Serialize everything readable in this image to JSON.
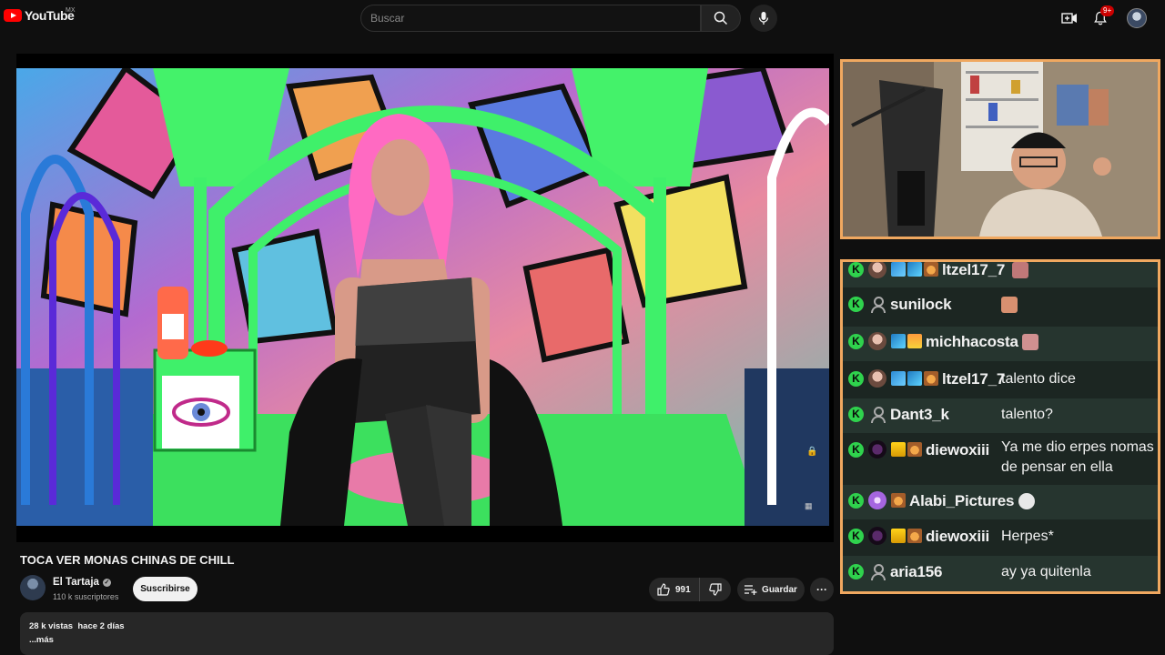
{
  "header": {
    "logo_text": "YouTube",
    "region": "MX",
    "search_placeholder": "Buscar",
    "notifications_badge": "9+"
  },
  "video": {
    "title": "TOCA VER MONAS CHINAS DE CHILL",
    "channel_name": "El Tartaja",
    "subscribers": "110 k suscriptores",
    "subscribe_label": "Suscribirse",
    "likes": "991",
    "save_label": "Guardar",
    "views": "28 k vistas",
    "date": "hace 2 días",
    "more_label": "...más"
  },
  "chat": {
    "messages": [
      {
        "user": "ltzel17_7",
        "badges": [
          "sword",
          "bg",
          "bear"
        ],
        "avatar": "photo",
        "text": "",
        "emote": "face"
      },
      {
        "user": "sunilock",
        "badges": [],
        "avatar": "default",
        "text": "",
        "emote": "hand"
      },
      {
        "user": "michhacosta",
        "badges": [
          "bg",
          "gift"
        ],
        "avatar": "photo",
        "text": "",
        "emote": "face"
      },
      {
        "user": "ltzel17_7",
        "badges": [
          "sword",
          "bg",
          "bear"
        ],
        "avatar": "photo",
        "text": "talento dice",
        "emote": ""
      },
      {
        "user": "Dant3_k",
        "badges": [],
        "avatar": "default",
        "text": "talento?",
        "emote": ""
      },
      {
        "user": "diewoxiii",
        "badges": [
          "crown",
          "bear"
        ],
        "avatar": "dark",
        "text": "Ya me dio erpes nomas de pensar en ella",
        "emote": ""
      },
      {
        "user": "Alabi_Pictures",
        "badges": [
          "bear"
        ],
        "avatar": "purple",
        "text": "",
        "emote": "skull"
      },
      {
        "user": "diewoxiii",
        "badges": [
          "crown",
          "bear"
        ],
        "avatar": "dark",
        "text": "Herpes*",
        "emote": ""
      },
      {
        "user": "aria156",
        "badges": [],
        "avatar": "default",
        "text": "ay ya quitenla",
        "emote": ""
      }
    ]
  },
  "colors": {
    "accent_red": "#ff0000",
    "stream_border": "#f0a860",
    "chat_badge": "#2fd24d"
  }
}
